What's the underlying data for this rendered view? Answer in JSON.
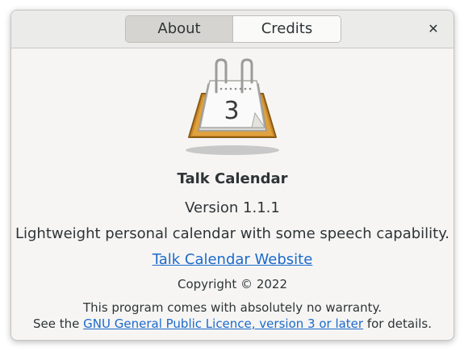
{
  "tabs": {
    "about": "About",
    "credits": "Credits"
  },
  "close_icon": "close-icon",
  "app": {
    "icon": "calendar-icon",
    "calendar_day": "3",
    "name": "Talk Calendar",
    "version": "Version 1.1.1",
    "comments": "Lightweight personal calendar with some speech capability.",
    "website": "Talk Calendar Website",
    "copyright": "Copyright © 2022"
  },
  "license": {
    "line1": "This program comes with absolutely no warranty.",
    "line2_prefix": "See the ",
    "link": "GNU General Public Licence, version 3 or later",
    "line2_suffix": " for details."
  },
  "colors": {
    "link": "#1b6acb",
    "text": "#2e3436",
    "background": "#f6f5f4"
  }
}
